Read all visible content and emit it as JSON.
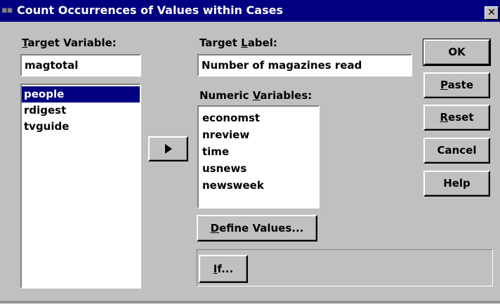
{
  "window": {
    "title": "Count Occurrences of Values within Cases",
    "close_glyph": "✕"
  },
  "target_variable": {
    "label_accel": "T",
    "label_rest": "arget Variable:",
    "value": "magtotal"
  },
  "target_label": {
    "label_pre": "Target ",
    "label_accel": "L",
    "label_rest": "abel:",
    "value": "Number of magazines read"
  },
  "source_list": {
    "items": [
      {
        "label": "people",
        "selected": true
      },
      {
        "label": "rdigest",
        "selected": false
      },
      {
        "label": "tvguide",
        "selected": false
      }
    ]
  },
  "transfer_button": {
    "icon": "arrow-right-icon"
  },
  "numeric_variables": {
    "label_pre": "Numeric ",
    "label_accel": "V",
    "label_rest": "ariables:",
    "items": [
      "economst",
      "nreview",
      "time",
      "usnews",
      "newsweek"
    ]
  },
  "define_values_button": {
    "accel": "D",
    "rest": "efine Values..."
  },
  "if_button": {
    "accel": "I",
    "rest": "f..."
  },
  "buttons": {
    "ok": "OK",
    "paste": {
      "accel": "P",
      "rest": "aste"
    },
    "reset": {
      "accel": "R",
      "rest": "eset"
    },
    "cancel": "Cancel",
    "help": "Help"
  },
  "colors": {
    "title_bar": "#000080",
    "dialog_face": "#c0c0c0",
    "selection": "#000080"
  }
}
